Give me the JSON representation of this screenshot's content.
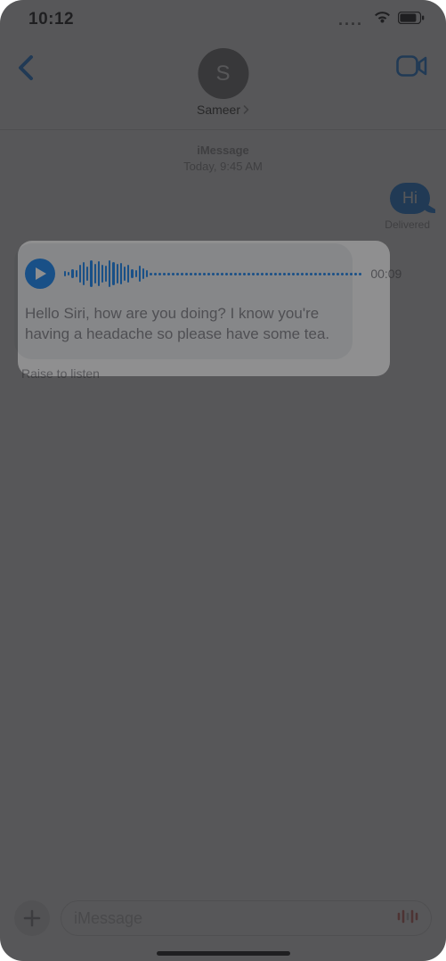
{
  "status": {
    "time": "10:12"
  },
  "header": {
    "avatar_initial": "S",
    "contact_name": "Sameer"
  },
  "thread_meta": {
    "line1": "iMessage",
    "line2": "Today,  9:45 AM"
  },
  "outgoing": {
    "text": "Hi",
    "status": "Delivered"
  },
  "audio": {
    "duration": "00:09",
    "transcript": "Hello Siri, how are you doing? I know you're having a headache so please have some tea.",
    "raise_label": "Raise to listen"
  },
  "compose": {
    "placeholder": "iMessage"
  }
}
